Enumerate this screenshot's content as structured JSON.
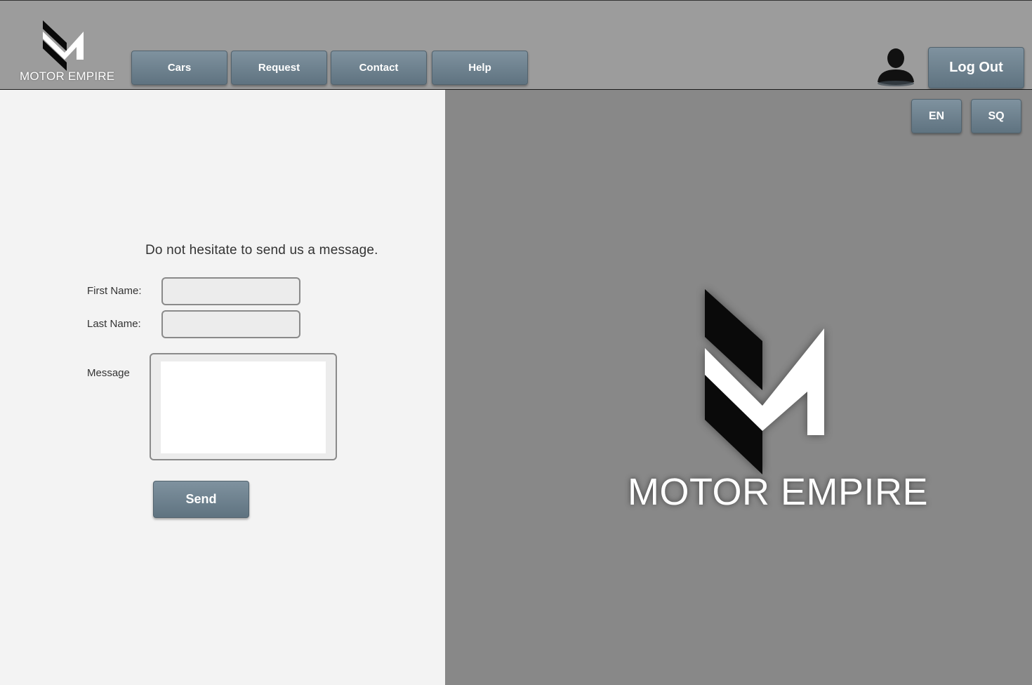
{
  "brand": {
    "name": "MOTOR EMPIRE"
  },
  "nav": {
    "items": [
      {
        "label": "Cars"
      },
      {
        "label": "Request"
      },
      {
        "label": "Contact"
      },
      {
        "label": "Help"
      }
    ]
  },
  "user": {
    "icon": "user-silhouette-icon",
    "logout_label": "Log Out"
  },
  "language": {
    "options": [
      "EN",
      "SQ"
    ]
  },
  "contact_form": {
    "heading": "Do not hesitate to send us a message.",
    "first_name_label": "First Name:",
    "first_name_value": "",
    "last_name_label": "Last Name:",
    "last_name_value": "",
    "message_label": "Message",
    "message_value": "",
    "send_label": "Send"
  },
  "colors": {
    "header_bg": "#9c9c9c",
    "button_bg": "#6b7f8c",
    "left_panel_bg": "#f3f3f3",
    "right_panel_bg": "#888888"
  }
}
